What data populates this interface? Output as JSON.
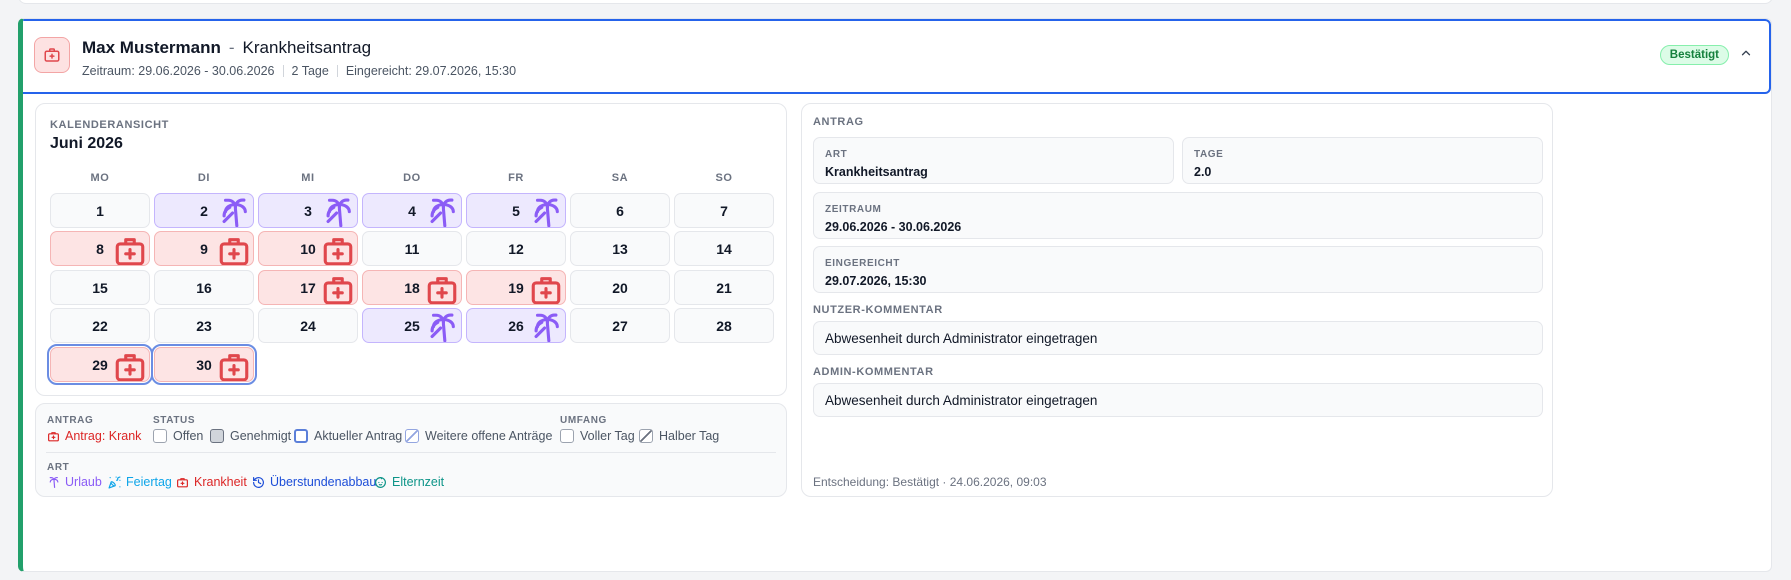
{
  "header": {
    "name": "Max Mustermann",
    "separator": "-",
    "request_type": "Krankheitsantrag",
    "period_text": "Zeitraum: 29.06.2026 - 30.06.2026",
    "days_text": "2 Tage",
    "submitted_text": "Eingereicht: 29.07.2026, 15:30",
    "status": "Bestätigt"
  },
  "calendar": {
    "eyebrow": "KALENDERANSICHT",
    "month": "Juni 2026",
    "weekdays": [
      "MO",
      "DI",
      "MI",
      "DO",
      "FR",
      "SA",
      "SO"
    ],
    "days": [
      {
        "label": "1",
        "type": "none"
      },
      {
        "label": "2",
        "type": "vacation"
      },
      {
        "label": "3",
        "type": "vacation"
      },
      {
        "label": "4",
        "type": "vacation"
      },
      {
        "label": "5",
        "type": "vacation"
      },
      {
        "label": "6",
        "type": "none"
      },
      {
        "label": "7",
        "type": "none"
      },
      {
        "label": "8",
        "type": "sick"
      },
      {
        "label": "9",
        "type": "sick"
      },
      {
        "label": "10",
        "type": "sick"
      },
      {
        "label": "11",
        "type": "none"
      },
      {
        "label": "12",
        "type": "none"
      },
      {
        "label": "13",
        "type": "none"
      },
      {
        "label": "14",
        "type": "none"
      },
      {
        "label": "15",
        "type": "none"
      },
      {
        "label": "16",
        "type": "none"
      },
      {
        "label": "17",
        "type": "sick"
      },
      {
        "label": "18",
        "type": "sick"
      },
      {
        "label": "19",
        "type": "sick"
      },
      {
        "label": "20",
        "type": "none"
      },
      {
        "label": "21",
        "type": "none"
      },
      {
        "label": "22",
        "type": "none"
      },
      {
        "label": "23",
        "type": "none"
      },
      {
        "label": "24",
        "type": "none"
      },
      {
        "label": "25",
        "type": "vacation"
      },
      {
        "label": "26",
        "type": "vacation"
      },
      {
        "label": "27",
        "type": "none"
      },
      {
        "label": "28",
        "type": "none"
      },
      {
        "label": "29",
        "type": "sick",
        "current": true
      },
      {
        "label": "30",
        "type": "sick",
        "current": true
      }
    ]
  },
  "legend": {
    "antrag_heading": "ANTRAG",
    "antrag_item": "Antrag: Krank",
    "status_heading": "STATUS",
    "status_items": [
      "Offen",
      "Genehmigt",
      "Aktueller Antrag",
      "Weitere offene Anträge"
    ],
    "umfang_heading": "UMFANG",
    "umfang_items": [
      "Voller Tag",
      "Halber Tag"
    ],
    "art_heading": "ART",
    "art_items": [
      {
        "label": "Urlaub",
        "color": "#8b5cf6",
        "icon": "palm-icon"
      },
      {
        "label": "Feiertag",
        "color": "#0ea5e9",
        "icon": "party-icon"
      },
      {
        "label": "Krankheit",
        "color": "#dc2626",
        "icon": "medkit-icon"
      },
      {
        "label": "Überstundenabbau",
        "color": "#1d4ed8",
        "icon": "clock-icon"
      },
      {
        "label": "Elternzeit",
        "color": "#0d9488",
        "icon": "baby-icon"
      }
    ]
  },
  "antrag": {
    "eyebrow": "ANTRAG",
    "art_label": "ART",
    "art_value": "Krankheitsantrag",
    "tage_label": "TAGE",
    "tage_value": "2.0",
    "zeitraum_label": "ZEITRAUM",
    "zeitraum_value": "29.06.2026 - 30.06.2026",
    "eingereicht_label": "EINGEREICHT",
    "eingereicht_value": "29.07.2026, 15:30",
    "user_comment_label": "NUTZER-KOMMENTAR",
    "user_comment": "Abwesenheit durch Administrator eingetragen",
    "admin_comment_label": "ADMIN-KOMMENTAR",
    "admin_comment": "Abwesenheit durch Administrator eingetragen",
    "decision": "Entscheidung: Bestätigt · 24.06.2026, 09:03"
  },
  "colors": {
    "accent_green": "#22a06b",
    "accent_blue": "#2563eb",
    "vacation": "#8b5cf6",
    "sick": "#e0474c"
  }
}
